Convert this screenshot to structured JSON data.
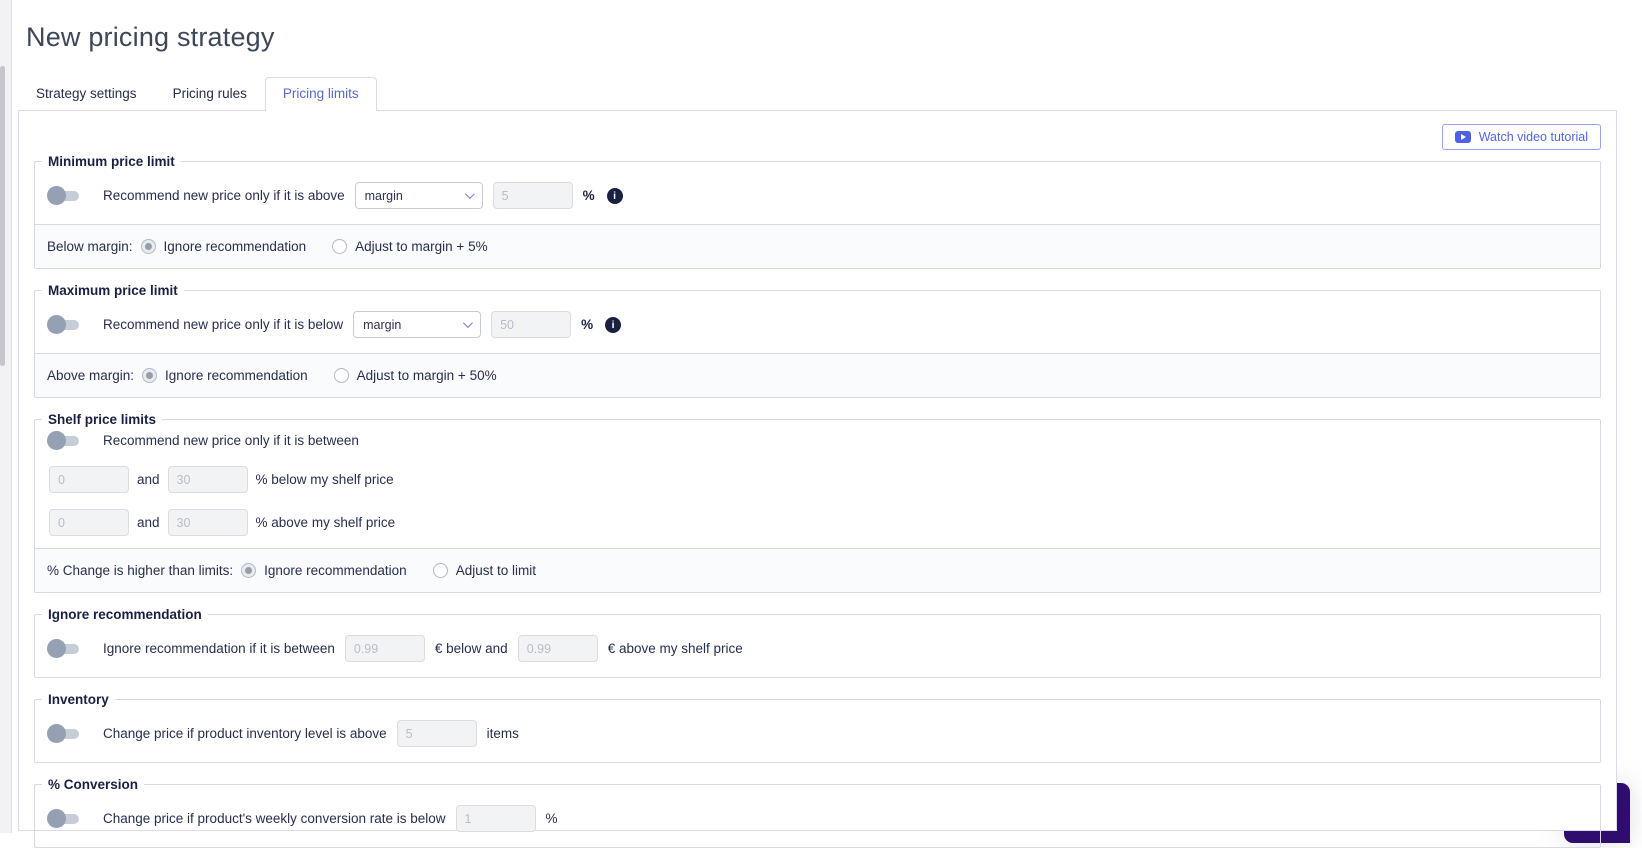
{
  "page": {
    "title": "New pricing strategy"
  },
  "tabs": [
    {
      "label": "Strategy settings",
      "active": false
    },
    {
      "label": "Pricing rules",
      "active": false
    },
    {
      "label": "Pricing limits",
      "active": true
    }
  ],
  "toolbar": {
    "watch_video_label": "Watch video tutorial"
  },
  "icons": {
    "info": "i"
  },
  "colors": {
    "accent": "#5a68d6",
    "legend_text": "#1a2140",
    "body_text": "#262e4e",
    "panel_border": "#d9dce6",
    "chat_background": "#2e0d6e",
    "toggle_knob": "#95a0b3"
  },
  "sections": {
    "minimum": {
      "legend": "Minimum price limit",
      "toggle_label": "Recommend new price only if it is above",
      "select_value": "margin",
      "input_placeholder": "5",
      "unit": "%",
      "radio_row": {
        "label": "Below margin:",
        "options": [
          {
            "label": "Ignore recommendation",
            "selected": true
          },
          {
            "label": "Adjust to margin + 5%",
            "selected": false
          }
        ]
      }
    },
    "maximum": {
      "legend": "Maximum price limit",
      "toggle_label": "Recommend new price only if it is below",
      "select_value": "margin",
      "input_placeholder": "50",
      "unit": "%",
      "radio_row": {
        "label": "Above margin:",
        "options": [
          {
            "label": "Ignore recommendation",
            "selected": true
          },
          {
            "label": "Adjust to margin + 50%",
            "selected": false
          }
        ]
      }
    },
    "shelf": {
      "legend": "Shelf price limits",
      "toggle_label": "Recommend new price only if it is between",
      "lines": [
        {
          "input1": "0",
          "connector": "and",
          "input2": "30",
          "suffix": "% below my shelf price"
        },
        {
          "input1": "0",
          "connector": "and",
          "input2": "30",
          "suffix": "% above my shelf price"
        }
      ],
      "radio_row": {
        "label": "% Change is higher than limits:",
        "options": [
          {
            "label": "Ignore recommendation",
            "selected": true
          },
          {
            "label": "Adjust to limit",
            "selected": false
          }
        ]
      }
    },
    "ignore": {
      "legend": "Ignore recommendation",
      "toggle_label": "Ignore recommendation if it is between",
      "input1_placeholder": "0.99",
      "mid_label": "€ below and",
      "input2_placeholder": "0.99",
      "suffix": "€ above my shelf price"
    },
    "inventory": {
      "legend": "Inventory",
      "toggle_label": "Change price if product inventory level is above",
      "input_placeholder": "5",
      "suffix": "items"
    },
    "conversion": {
      "legend": "% Conversion",
      "toggle_label": "Change price if product's weekly conversion rate is below",
      "input_placeholder": "1",
      "suffix": "%"
    }
  }
}
